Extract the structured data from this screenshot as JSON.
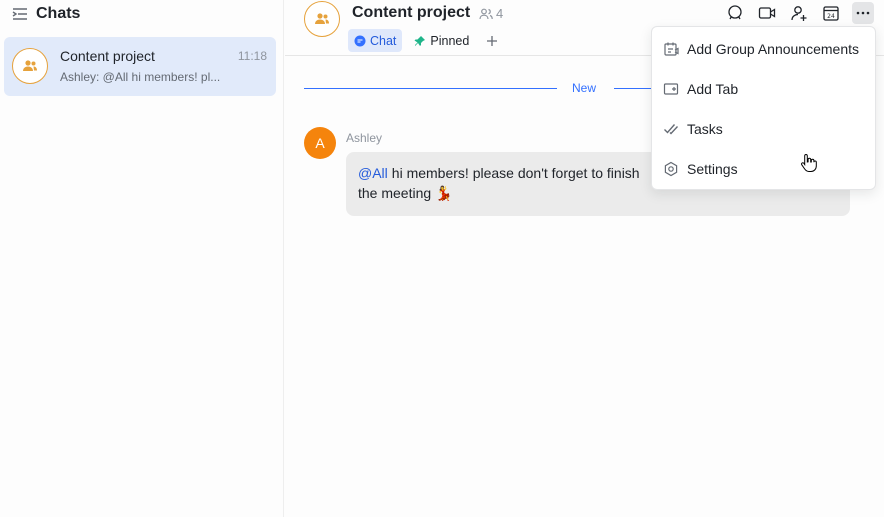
{
  "sidebar": {
    "title": "Chats",
    "chats": [
      {
        "name": "Content project",
        "time": "11:18",
        "preview": "Ashley: @All hi members! pl..."
      }
    ]
  },
  "header": {
    "title": "Content project",
    "member_count": "4",
    "tabs": [
      {
        "label": "Chat",
        "active": true
      },
      {
        "label": "Pinned",
        "active": false
      }
    ]
  },
  "divider": {
    "label": "New"
  },
  "message": {
    "avatar_letter": "A",
    "sender": "Ashley",
    "mention": "@All",
    "text_line1": "hi members! please don't forget to finish",
    "text_line2": "the meeting",
    "emoji": "💃"
  },
  "menu": {
    "items": [
      {
        "label": "Add Group Announcements",
        "icon": "announcement-icon"
      },
      {
        "label": "Add Tab",
        "icon": "add-tab-icon"
      },
      {
        "label": "Tasks",
        "icon": "tasks-icon"
      },
      {
        "label": "Settings",
        "icon": "settings-icon"
      }
    ]
  },
  "colors": {
    "accent": "#3370ff",
    "selected_bg": "#e1eafa",
    "avatar_orange": "#f5840c",
    "group_ring": "#e6a23c"
  }
}
